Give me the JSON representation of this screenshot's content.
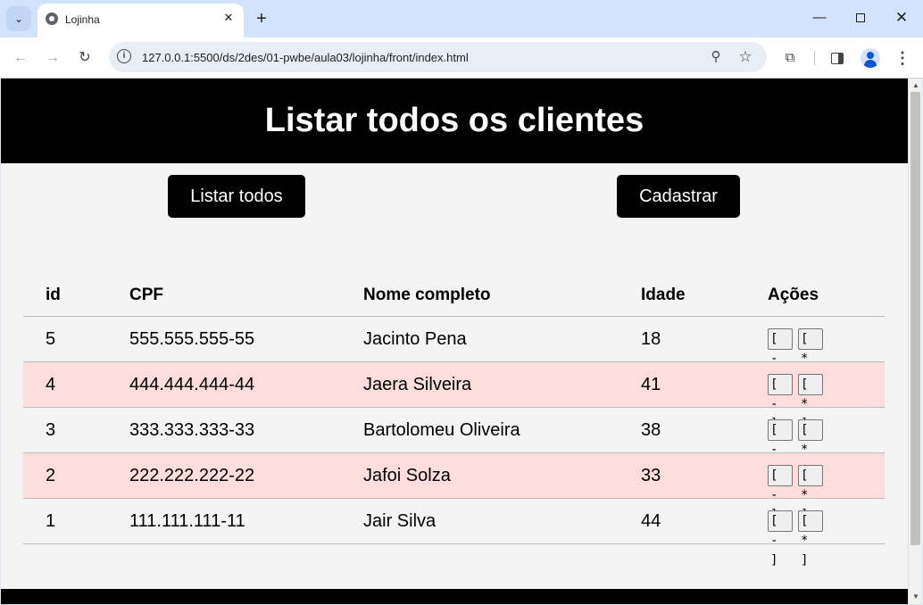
{
  "browser": {
    "tab_title": "Lojinha",
    "url": "127.0.0.1:5500/ds/2des/01-pwbe/aula03/lojinha/front/index.html"
  },
  "page": {
    "title": "Listar todos os clientes",
    "buttons": {
      "list_all": "Listar todos",
      "register": "Cadastrar"
    }
  },
  "table": {
    "headers": {
      "id": "id",
      "cpf": "CPF",
      "nome": "Nome completo",
      "idade": "Idade",
      "acoes": "Ações"
    },
    "action_labels": {
      "delete": "[ - ]",
      "edit": "[ * ]"
    },
    "rows": [
      {
        "id": "5",
        "cpf": "555.555.555-55",
        "nome": "Jacinto Pena",
        "idade": "18"
      },
      {
        "id": "4",
        "cpf": "444.444.444-44",
        "nome": "Jaera Silveira",
        "idade": "41"
      },
      {
        "id": "3",
        "cpf": "333.333.333-33",
        "nome": "Bartolomeu Oliveira",
        "idade": "38"
      },
      {
        "id": "2",
        "cpf": "222.222.222-22",
        "nome": "Jafoi Solza",
        "idade": "33"
      },
      {
        "id": "1",
        "cpf": "111.111.111-11",
        "nome": "Jair Silva",
        "idade": "44"
      }
    ]
  },
  "colors": {
    "header_bg": "#000000",
    "alt_row_bg": "#ffdddd",
    "page_bg": "#f4f4f4"
  }
}
